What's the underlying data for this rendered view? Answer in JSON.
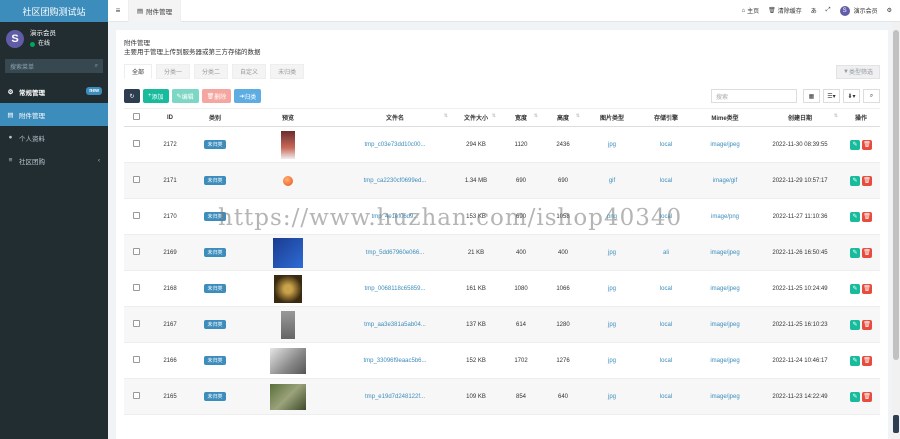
{
  "sidebar": {
    "brand": "社区团购测试站",
    "avatar_letter": "S",
    "user_name": "演示会员",
    "user_status": "在线",
    "search_placeholder": "搜索菜单",
    "items": [
      {
        "label": "常规管理",
        "badge": "new",
        "icon": "gear-icon"
      },
      {
        "label": "附件管理",
        "icon": "file-icon"
      },
      {
        "label": "个人资料",
        "icon": "user-icon"
      },
      {
        "label": "社区团购",
        "icon": "list-icon"
      }
    ]
  },
  "topnav": {
    "active_tab": "附件管理",
    "home": "主页",
    "clear_cache": "清除缓存",
    "user": "演示会员"
  },
  "panel": {
    "title": "附件管理",
    "description": "主要用于管理上传到服务器或第三方存储的数据",
    "tabs": [
      "全部",
      "分类一",
      "分类二",
      "自定义",
      "未归类"
    ],
    "filter_button": "类型筛选"
  },
  "toolbar": {
    "add": "添加",
    "edit": "编辑",
    "delete": "删除",
    "import": "归类",
    "search_placeholder": "搜索"
  },
  "table": {
    "headers": [
      "ID",
      "类别",
      "预览",
      "文件名",
      "文件大小",
      "宽度",
      "高度",
      "图片类型",
      "存储引擎",
      "Mime类型",
      "创建日期",
      "操作"
    ],
    "rows": [
      {
        "id": "2172",
        "category": "未归类",
        "thumb": "phone",
        "filename": "tmp_c03e73dd10c00...",
        "size": "294 KB",
        "width": "1120",
        "height": "2436",
        "img_type": "jpg",
        "storage": "local",
        "mime": "image/jpeg",
        "created": "2022-11-30 08:39:55"
      },
      {
        "id": "2171",
        "category": "未归类",
        "thumb": "emoji",
        "filename": "tmp_ca2230cf0699ed...",
        "size": "1.34 MB",
        "width": "690",
        "height": "690",
        "img_type": "gif",
        "storage": "local",
        "mime": "image/gif",
        "created": "2022-11-29 10:57:17"
      },
      {
        "id": "2170",
        "category": "未归类",
        "thumb": "none",
        "filename": "tmp_4e1ef06d9...",
        "size": "153 KB",
        "width": "690",
        "height": "1058",
        "img_type": "png",
        "storage": "local",
        "mime": "image/png",
        "created": "2022-11-27 11:10:36"
      },
      {
        "id": "2169",
        "category": "未归类",
        "thumb": "app",
        "filename": "tmp_5dd67960e066...",
        "size": "21 KB",
        "width": "400",
        "height": "400",
        "img_type": "jpg",
        "storage": "ali",
        "mime": "image/jpeg",
        "created": "2022-11-26 16:50:45"
      },
      {
        "id": "2168",
        "category": "未归类",
        "thumb": "photo-dark",
        "filename": "tmp_0068118c65859...",
        "size": "161 KB",
        "width": "1080",
        "height": "1066",
        "img_type": "jpg",
        "storage": "local",
        "mime": "image/jpeg",
        "created": "2022-11-25 10:24:49"
      },
      {
        "id": "2167",
        "category": "未归类",
        "thumb": "photo-grey",
        "filename": "tmp_aa3e381a5ab04...",
        "size": "137 KB",
        "width": "614",
        "height": "1280",
        "img_type": "jpg",
        "storage": "local",
        "mime": "image/jpeg",
        "created": "2022-11-25 16:10:23"
      },
      {
        "id": "2166",
        "category": "未归类",
        "thumb": "photo-light",
        "filename": "tmp_33096f9eaac5b6...",
        "size": "152 KB",
        "width": "1702",
        "height": "1276",
        "img_type": "jpg",
        "storage": "local",
        "mime": "image/jpeg",
        "created": "2022-11-24 10:46:17"
      },
      {
        "id": "2165",
        "category": "未归类",
        "thumb": "photo-green",
        "filename": "tmp_e19d7d248122f...",
        "size": "109 KB",
        "width": "854",
        "height": "640",
        "img_type": "jpg",
        "storage": "local",
        "mime": "image/jpeg",
        "created": "2022-11-23 14:22:49"
      }
    ]
  },
  "watermark": "https://www.huzhan.com/ishop40340",
  "colors": {
    "accent": "#3c8dbc",
    "sidebar": "#222d32",
    "success": "#18bc9c",
    "danger": "#e74c3c"
  }
}
